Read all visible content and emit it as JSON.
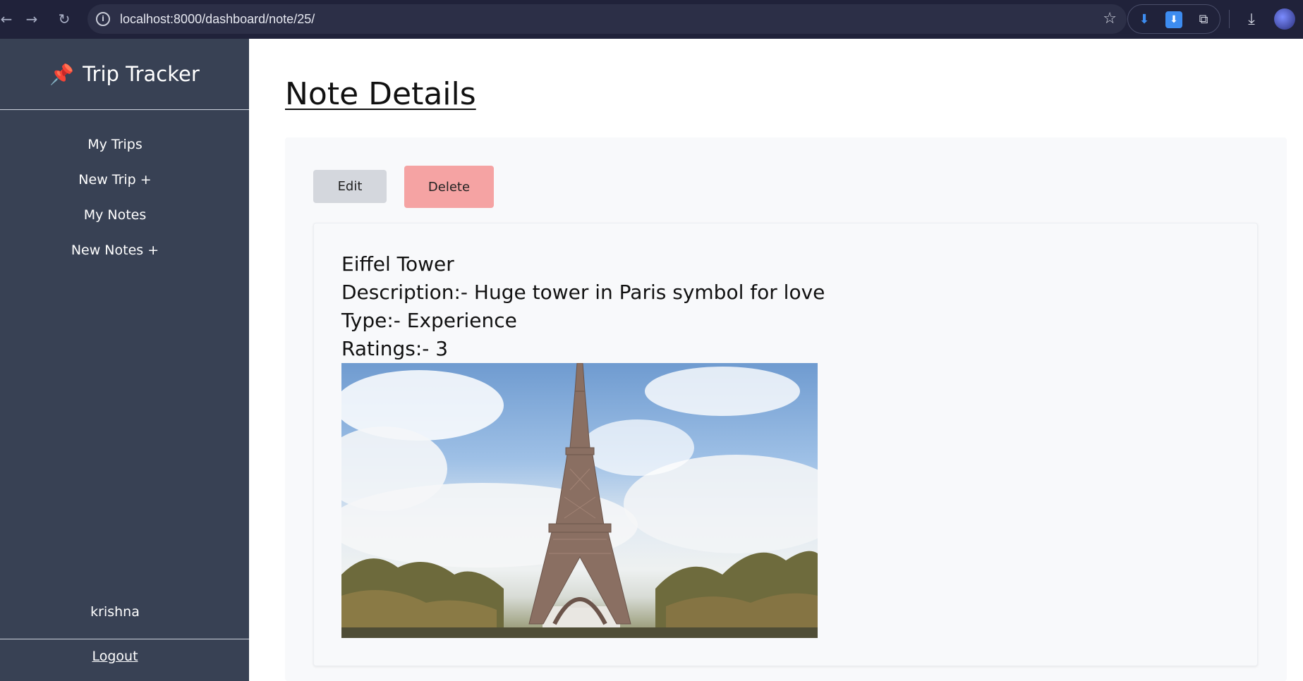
{
  "browser": {
    "url": "localhost:8000/dashboard/note/25/"
  },
  "sidebar": {
    "brand": "Trip Tracker",
    "items": [
      {
        "label": "My Trips"
      },
      {
        "label": "New Trip +"
      },
      {
        "label": "My Notes"
      },
      {
        "label": "New Notes +"
      }
    ],
    "username": "krishna",
    "logout": "Logout"
  },
  "main": {
    "title": "Note Details",
    "edit_label": "Edit",
    "delete_label": "Delete",
    "note": {
      "name": "Eiffel Tower",
      "description": "Description:- Huge tower in Paris symbol for love",
      "type": "Type:- Experience",
      "ratings": "Ratings:- 3"
    }
  },
  "colors": {
    "sidebar_bg": "#384154",
    "delete_button": "#f5a3a3",
    "edit_button": "#d4d7dd",
    "chrome_bg": "#20223a"
  }
}
